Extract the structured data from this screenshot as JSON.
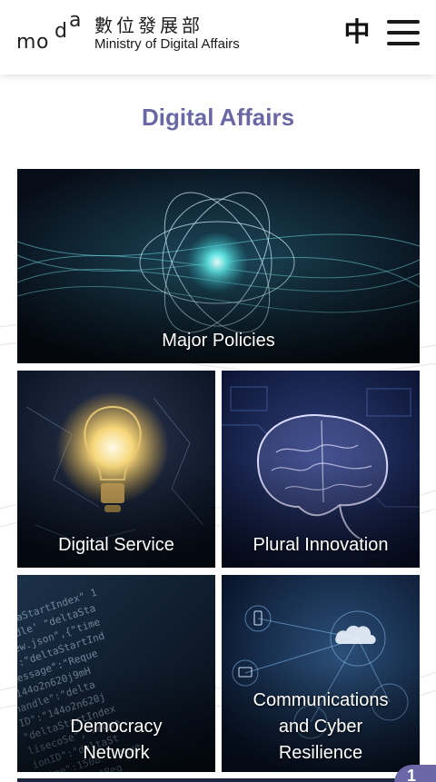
{
  "header": {
    "logo_letters": [
      "m",
      "o",
      "d",
      "a"
    ],
    "ministry_name_zh": "數位發展部",
    "ministry_name_en": "Ministry of Digital Affairs",
    "language_toggle": "中",
    "menu_icon": "hamburger-menu-icon"
  },
  "main": {
    "title": "Digital Affairs",
    "tiles": [
      {
        "label": "Major Policies",
        "image": "atom-network-globe"
      },
      {
        "label": "Digital Service",
        "image": "glowing-lightbulb-world-map"
      },
      {
        "label": "Plural Innovation",
        "image": "glowing-brain-circuit"
      },
      {
        "label": "Democracy Network",
        "image": "code-text-screen"
      },
      {
        "label": "Communications and Cyber Resilience",
        "image": "cloud-device-network"
      }
    ]
  },
  "colors": {
    "accent": "#6b67a6",
    "header_bg": "#ffffff",
    "text_dark": "#1a1a1a",
    "tile_dark": "#0b1628"
  },
  "floating_button": {
    "label": "1"
  }
}
